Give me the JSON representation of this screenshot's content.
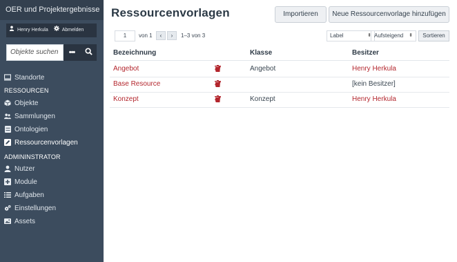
{
  "app": {
    "brand": "OER und Projektergebnisse"
  },
  "user": {
    "name": "Henry Herkula",
    "logout": "Abmelden"
  },
  "search": {
    "placeholder": "Objekte suchen"
  },
  "sidebar": {
    "top_items": [
      {
        "label": "Standorte",
        "icon": "monitor-icon"
      }
    ],
    "section_resources": "RESSOURCEN",
    "resources": [
      {
        "label": "Objekte",
        "icon": "cube-icon"
      },
      {
        "label": "Sammlungen",
        "icon": "users-icon"
      },
      {
        "label": "Ontologien",
        "icon": "server-icon"
      },
      {
        "label": "Ressourcenvorlagen",
        "icon": "edit-icon"
      }
    ],
    "section_admin": "ADMININSTRATOR",
    "admin": [
      {
        "label": "Nutzer",
        "icon": "user-icon"
      },
      {
        "label": "Module",
        "icon": "plus-square-icon"
      },
      {
        "label": "Aufgaben",
        "icon": "list-icon"
      },
      {
        "label": "Einstellungen",
        "icon": "cogs-icon"
      },
      {
        "label": "Assets",
        "icon": "image-icon"
      }
    ]
  },
  "page": {
    "title": "Ressourcenvorlagen",
    "import_label": "Importieren",
    "add_label": "Neue Ressourcenvorlage hinzufügen"
  },
  "pagination": {
    "page": "1",
    "of": "von 1",
    "range": "1–3 von 3",
    "sort_by": "Label",
    "sort_order": "Aufsteigend",
    "sort_button": "Sortieren"
  },
  "table": {
    "headers": {
      "label": "Bezeichnung",
      "class": "Klasse",
      "owner": "Besitzer"
    },
    "rows": [
      {
        "label": "Angebot",
        "class": "Angebot",
        "owner": "Henry Herkula"
      },
      {
        "label": "Base Resource",
        "class": "",
        "owner": "[kein Besitzer]"
      },
      {
        "label": "Konzept",
        "class": "Konzept",
        "owner": "Henry Herkula"
      }
    ]
  },
  "colors": {
    "sidebar": "#3c4c5e",
    "accent": "#b3262d"
  }
}
